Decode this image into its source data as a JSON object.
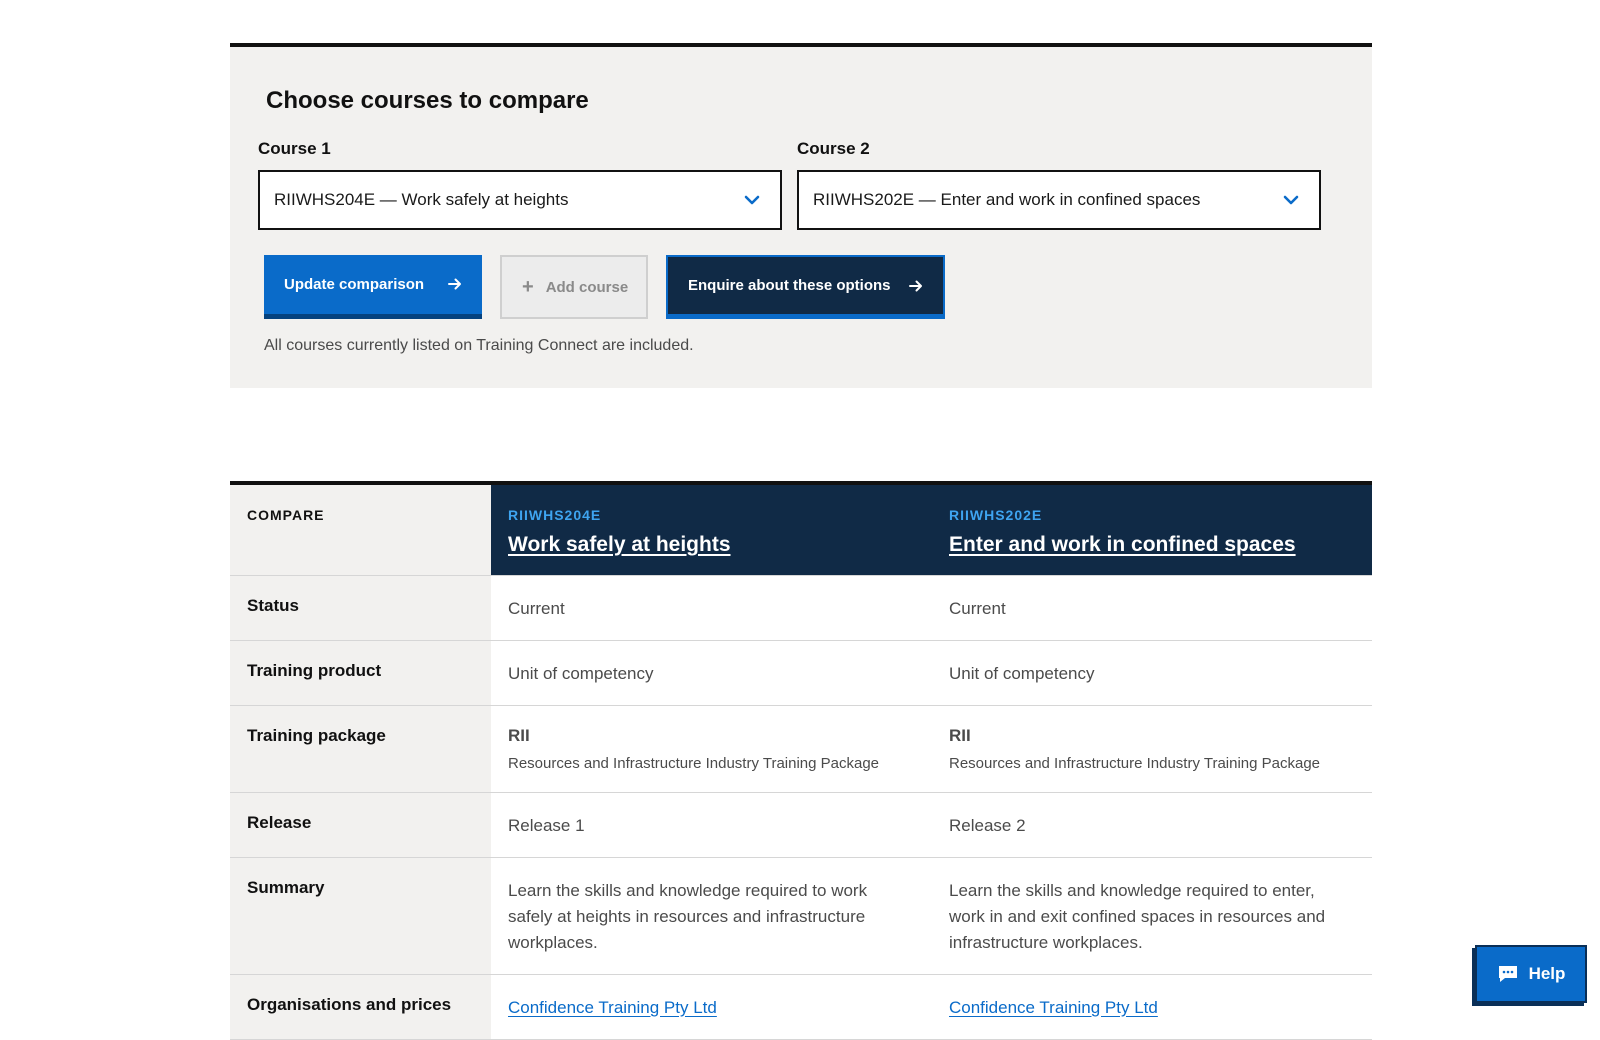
{
  "chooser": {
    "heading": "Choose courses to compare",
    "course1_label": "Course 1",
    "course1_value": "RIIWHS204E — Work safely at heights",
    "course2_label": "Course 2",
    "course2_value": "RIIWHS202E — Enter and work in confined spaces",
    "update_button": "Update comparison",
    "add_button": "Add course",
    "enquire_button": "Enquire about these options",
    "note": "All courses currently listed on Training Connect are included."
  },
  "compare": {
    "corner_label": "COMPARE",
    "courses": [
      {
        "code": "RIIWHS204E",
        "title": "Work safely at heights"
      },
      {
        "code": "RIIWHS202E",
        "title": "Enter and work in confined spaces"
      }
    ],
    "rows": {
      "status": {
        "label": "Status",
        "values": [
          "Current",
          "Current"
        ]
      },
      "product": {
        "label": "Training product",
        "values": [
          "Unit of competency",
          "Unit of competency"
        ]
      },
      "package": {
        "label": "Training package",
        "codes": [
          "RII",
          "RII"
        ],
        "names": [
          "Resources and Infrastructure Industry Training Package",
          "Resources and Infrastructure Industry Training Package"
        ]
      },
      "release": {
        "label": "Release",
        "values": [
          "Release 1",
          "Release 2"
        ]
      },
      "summary": {
        "label": "Summary",
        "values": [
          "Learn the skills and knowledge required to work safely at heights in resources and infrastructure workplaces.",
          "Learn the skills and knowledge required to enter, work in and exit confined spaces in resources and infrastructure workplaces."
        ]
      },
      "orgs": {
        "label": "Organisations and prices",
        "values": [
          "Confidence Training Pty Ltd",
          "Confidence Training Pty Ltd"
        ]
      }
    }
  },
  "help": {
    "label": "Help"
  },
  "colors": {
    "primary": "#0a6bc9",
    "navy": "#102a46",
    "accent_code": "#3ea4f0",
    "panel_bg": "#f2f1ef"
  },
  "icons": [
    "chevron-down-icon",
    "arrow-right-icon",
    "plus-icon",
    "chat-icon"
  ]
}
